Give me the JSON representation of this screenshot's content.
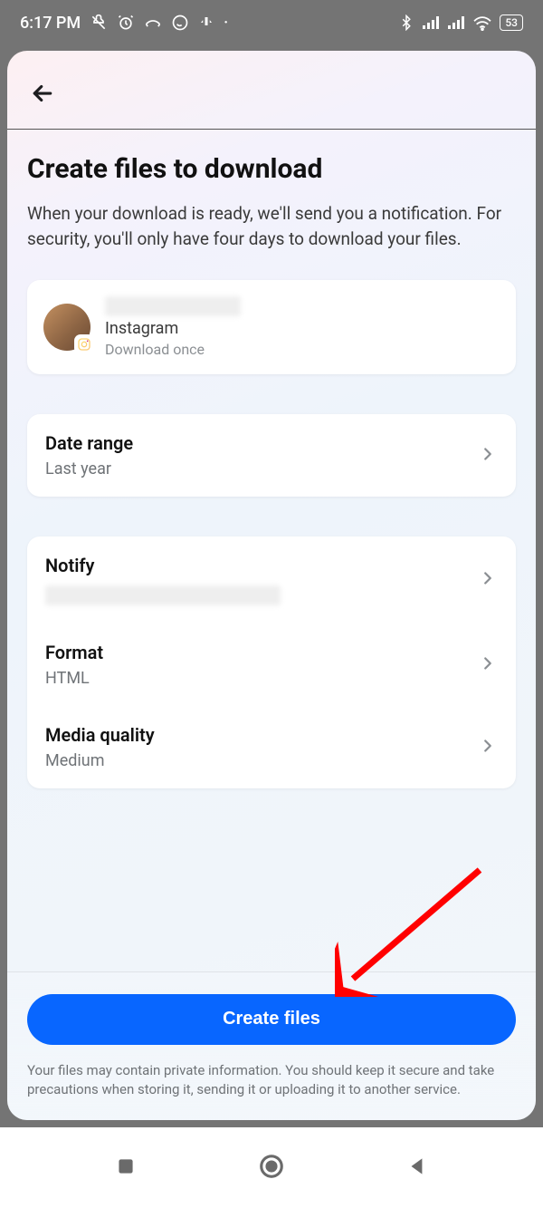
{
  "status": {
    "time": "6:17 PM",
    "battery": "53"
  },
  "page": {
    "title": "Create files to download",
    "description": "When your download is ready, we'll send you a notification. For security, you'll only have four days to download your files."
  },
  "account": {
    "platform": "Instagram",
    "sub": "Download once"
  },
  "settings": {
    "date_range": {
      "label": "Date range",
      "value": "Last year"
    },
    "notify": {
      "label": "Notify"
    },
    "format": {
      "label": "Format",
      "value": "HTML"
    },
    "media_quality": {
      "label": "Media quality",
      "value": "Medium"
    }
  },
  "cta": {
    "label": "Create files"
  },
  "disclaimer": "Your files may contain private information. You should keep it secure and take precautions when storing it, sending it or uploading it to another service."
}
